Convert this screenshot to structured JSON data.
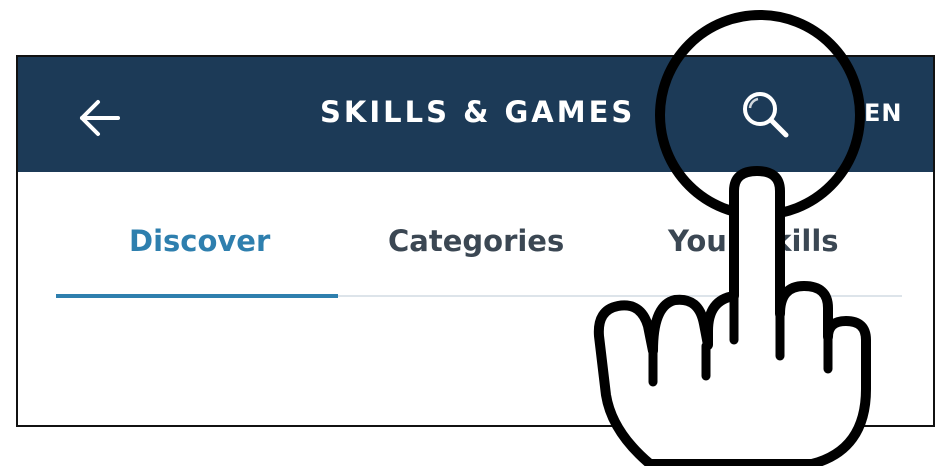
{
  "header": {
    "title": "SKILLS & GAMES",
    "language_partial": "EN",
    "back_icon": "arrow-left-icon",
    "search_icon": "search-icon"
  },
  "tabs": [
    {
      "label": "Discover",
      "active": true
    },
    {
      "label": "Categories",
      "active": false
    },
    {
      "label": "Your Skills",
      "active": false
    }
  ],
  "annotation": {
    "icon": "pointing-hand-icon",
    "highlight": "circle-highlight"
  },
  "colors": {
    "appbar": "#1c3a57",
    "active_tab": "#2e7fae",
    "inactive_tab": "#3b4753"
  }
}
